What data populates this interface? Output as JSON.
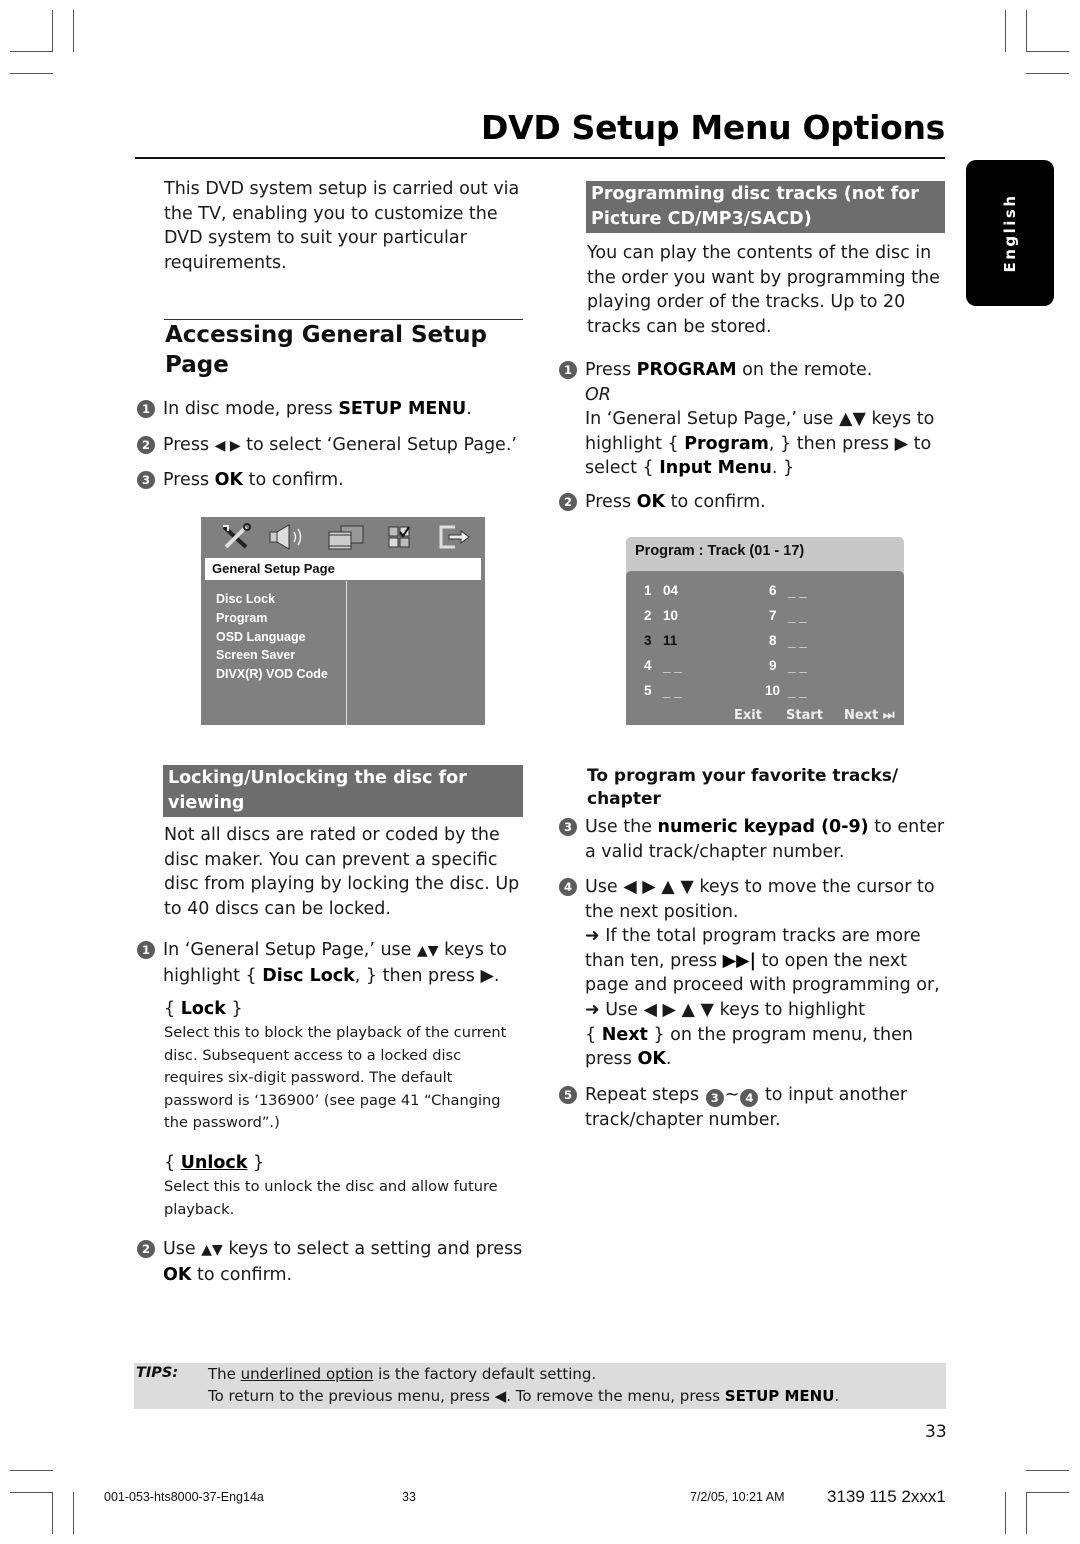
{
  "page": {
    "title": "DVD Setup Menu Options",
    "language_tab": "English",
    "page_number": "33"
  },
  "intro": "This DVD system setup is carried out via the TV, enabling you to customize the DVD system to suit your particular requirements.",
  "accessing": {
    "heading_line1": "Accessing General Setup",
    "heading_line2": "Page",
    "steps": [
      {
        "num": "1",
        "pre": "In disc mode, press ",
        "bold": "SETUP MENU",
        "post": "."
      },
      {
        "num": "2",
        "pre": "Press ",
        "keys": "◀ ▶",
        "post": " to select ‘General Setup Page.’"
      },
      {
        "num": "3",
        "pre": "Press ",
        "bold": "OK",
        "post": " to confirm."
      }
    ]
  },
  "general_setup_screen": {
    "icons": [
      "wrench-screwdriver-icon",
      "speaker-icon",
      "film-icon",
      "checkbox-grid-icon",
      "exit-icon"
    ],
    "selected_page": "General Setup Page",
    "items": [
      "Disc Lock",
      "Program",
      "OSD Language",
      "Screen Saver",
      "DIVX(R) VOD Code"
    ]
  },
  "locking": {
    "heading_line1": "Locking/Unlocking the disc for",
    "heading_line2": "viewing",
    "intro": [
      "Not all discs are rated or coded by the",
      "disc maker. You can prevent a specific",
      "disc from playing by locking the disc.  Up",
      "to 40 discs can be locked."
    ],
    "step1": {
      "num": "1",
      "line1_pre": "In ‘General Setup Page,’ use ",
      "line1_keys": "▲▼",
      "line1_post": " keys to",
      "line2_pre": "highlight { ",
      "line2_bold": "Disc Lock",
      "line2_post": ", } then press ▶."
    },
    "lock_option": {
      "open": "{ ",
      "label": "Lock",
      "close": " }",
      "desc": [
        "Select this to block the playback of the current",
        "disc.  Subsequent access to a locked disc",
        "requires six-digit password. The default",
        "password is ‘136900’ (see page 41 “Changing",
        "the password”.)"
      ]
    },
    "unlock_option": {
      "open": "{ ",
      "label": "Unlock",
      "close": " }",
      "desc": [
        "Select this to unlock the disc and allow future",
        "playback."
      ]
    },
    "step2": {
      "num": "2",
      "line1_pre": "Use ",
      "line1_keys": "▲▼",
      "line1_post": " keys to select a setting and press",
      "line2_bold": "OK",
      "line2_post": " to confirm."
    }
  },
  "programming": {
    "heading_line1": "Programming disc tracks (not for",
    "heading_line2": "Picture CD/MP3/SACD)",
    "intro": [
      "You can play the contents of the disc in",
      "the order you want by programming the",
      "playing order of the tracks. Up to 20",
      "tracks can be stored."
    ],
    "step1": {
      "num": "1",
      "line1_pre": "Press ",
      "line1_bold": "PROGRAM",
      "line1_post": " on the remote.",
      "or": "OR",
      "line2": "In ‘General Setup Page,’ use ▲▼ keys to",
      "line3_pre": "highlight { ",
      "line3_bold": "Program",
      "line3_post": ", } then press ▶ to",
      "line4_pre": "select { ",
      "line4_bold": "Input Menu",
      "line4_post": ". }"
    },
    "step2": {
      "num": "2",
      "pre": "Press ",
      "bold": "OK",
      "post": " to confirm."
    },
    "subheading_line1": "To program your favorite tracks/",
    "subheading_line2": "chapter",
    "step3": {
      "num": "3",
      "line1_pre": "Use the ",
      "line1_bold": "numeric keypad (0-9)",
      "line1_post": " to enter",
      "line2": "a valid track/chapter number."
    },
    "step4": {
      "num": "4",
      "line1": "Use ◀ ▶ ▲ ▼ keys to move the cursor to",
      "line2": "the next position.",
      "note1_line1": "➜ If the total program tracks are more",
      "note1_line2_pre": "than ten, press ",
      "note1_line2_key": "▶▶|",
      "note1_line2_post": " to open the next",
      "note1_line3": "page and proceed with programming or,",
      "note2_line1": "➜ Use ◀ ▶ ▲ ▼ keys to highlight",
      "note2_line2_pre": "{ ",
      "note2_line2_bold": "Next",
      "note2_line2_post": " } on the program menu, then",
      "note2_line3_pre": "press ",
      "note2_line3_bold": "OK",
      "note2_line3_post": "."
    },
    "step5": {
      "num": "5",
      "line1_pre": "Repeat steps ",
      "ref_a": "3",
      "tilde": "~",
      "ref_b": "4",
      "line1_post": " to input another",
      "line2": "track/chapter number."
    }
  },
  "program_screen": {
    "header": "Program : Track (01 - 17)",
    "slots_left": [
      {
        "index": "1",
        "value": "04",
        "selected": false
      },
      {
        "index": "2",
        "value": "10",
        "selected": false
      },
      {
        "index": "3",
        "value": "11",
        "selected": true
      },
      {
        "index": "4",
        "value": "_ _",
        "selected": false
      },
      {
        "index": "5",
        "value": "_ _",
        "selected": false
      }
    ],
    "slots_right": [
      {
        "index": "6",
        "value": "_ _"
      },
      {
        "index": "7",
        "value": "_ _"
      },
      {
        "index": "8",
        "value": "_ _"
      },
      {
        "index": "9",
        "value": "_ _"
      },
      {
        "index": "10",
        "value": "_ _"
      }
    ],
    "buttons": {
      "exit": "Exit",
      "start": "Start",
      "next": "Next ⏭"
    }
  },
  "tips": {
    "label": "TIPS:",
    "line1_pre": "The ",
    "line1_underlined": "underlined option",
    "line1_post": " is the factory default setting.",
    "line2_pre": "To return to the previous menu, press ◀.  To remove the menu, press ",
    "line2_bold": "SETUP MENU",
    "line2_post": "."
  },
  "footer": {
    "file": "001-053-hts8000-37-Eng14a",
    "page": "33",
    "date": "7/2/05, 10:21 AM",
    "code": "3139 115 2xxx1"
  }
}
